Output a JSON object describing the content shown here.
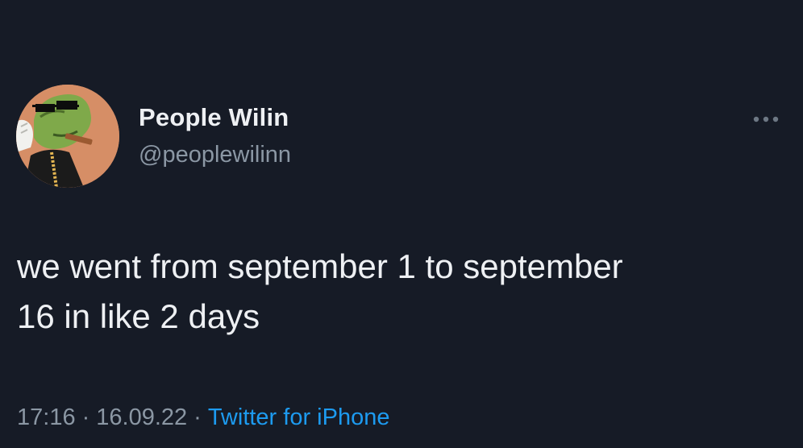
{
  "tweet": {
    "author": {
      "display_name": "People Wilin",
      "handle": "@peoplewilinn",
      "avatar_icon": "frog-avatar"
    },
    "more_icon": "more-horizontal-icon",
    "text_lines": [
      "we went from september 1 to september",
      "16 in like 2 days"
    ],
    "meta": {
      "time": "17:16",
      "separator": "·",
      "date": "16.09.22",
      "source": "Twitter for iPhone"
    }
  },
  "colors": {
    "background": "#161b26",
    "text": "#eef0f3",
    "muted": "#8b97a4",
    "link": "#1d9bf0",
    "avatar_bg": "#d68e66"
  }
}
